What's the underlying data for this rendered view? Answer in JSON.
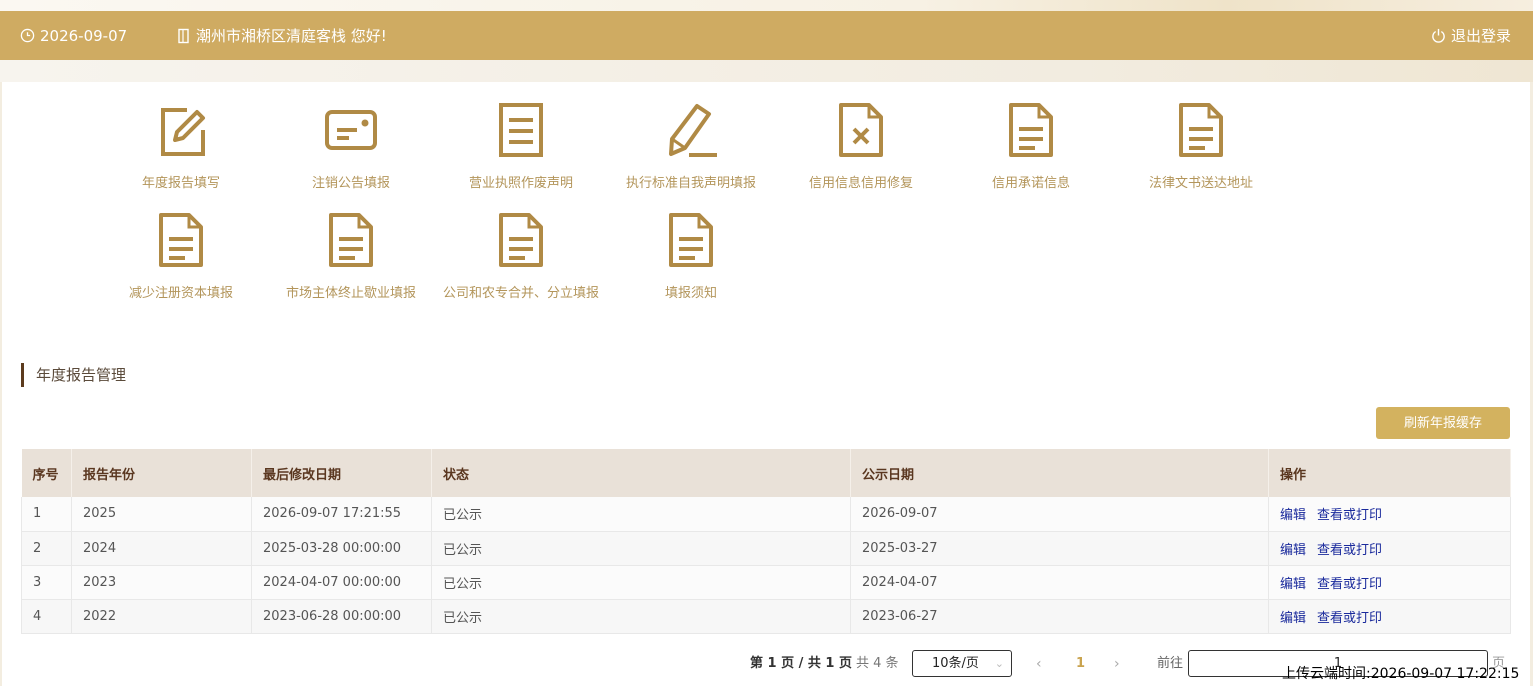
{
  "header": {
    "date": "2026-09-07",
    "greeting": "潮州市湘桥区清庭客栈 您好!",
    "logout_label": "退出登录"
  },
  "shortcuts": [
    {
      "label": "年度报告填写",
      "icon": "edit-icon"
    },
    {
      "label": "注销公告填报",
      "icon": "card-icon"
    },
    {
      "label": "营业执照作废声明",
      "icon": "document-icon"
    },
    {
      "label": "执行标准自我声明填报",
      "icon": "pencil-icon"
    },
    {
      "label": "信用信息信用修复",
      "icon": "document-x-icon"
    },
    {
      "label": "信用承诺信息",
      "icon": "document-icon"
    },
    {
      "label": "法律文书送达地址",
      "icon": "document-icon"
    },
    {
      "label": "减少注册资本填报",
      "icon": "document-icon"
    },
    {
      "label": "市场主体终止歇业填报",
      "icon": "document-icon"
    },
    {
      "label": "公司和农专合并、分立填报",
      "icon": "document-icon"
    },
    {
      "label": "填报须知",
      "icon": "document-icon"
    }
  ],
  "section": {
    "title": "年度报告管理",
    "refresh_label": "刷新年报缓存"
  },
  "table": {
    "columns": [
      "序号",
      "报告年份",
      "最后修改日期",
      "状态",
      "公示日期",
      "操作"
    ],
    "rows": [
      {
        "no": "1",
        "year": "2025",
        "modified": "2026-09-07 17:21:55",
        "status": "已公示",
        "publish": "2026-09-07",
        "edit": "编辑",
        "view": "查看或打印"
      },
      {
        "no": "2",
        "year": "2024",
        "modified": "2025-03-28 00:00:00",
        "status": "已公示",
        "publish": "2025-03-27",
        "edit": "编辑",
        "view": "查看或打印"
      },
      {
        "no": "3",
        "year": "2023",
        "modified": "2024-04-07 00:00:00",
        "status": "已公示",
        "publish": "2024-04-07",
        "edit": "编辑",
        "view": "查看或打印"
      },
      {
        "no": "4",
        "year": "2022",
        "modified": "2023-06-28 00:00:00",
        "status": "已公示",
        "publish": "2023-06-27",
        "edit": "编辑",
        "view": "查看或打印"
      }
    ]
  },
  "pagination": {
    "page_info": "第 1 页 / 共 1 页",
    "total": "共 4 条",
    "page_size": "10条/页",
    "current_page": "1",
    "goto_label": "前往",
    "goto_value": "1",
    "goto_suffix": "页"
  },
  "upload_time": "上传云端时间:2026-09-07 17:22:15",
  "colors": {
    "header_bg": "#cfab62",
    "accent_gold": "#b08a45",
    "label_gold": "#b3955a",
    "link_blue": "#1a2a9c",
    "button_gold": "#d3b25f"
  }
}
